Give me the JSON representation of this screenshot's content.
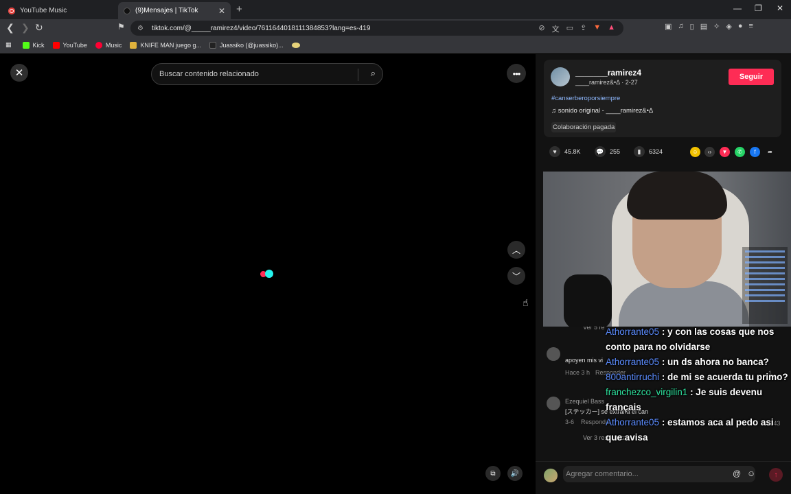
{
  "browser": {
    "tabs": [
      {
        "label": "YouTube Music",
        "icon": "youtube-music-icon",
        "active": false
      },
      {
        "label": "(9)Mensajes | TikTok",
        "icon": "tiktok-icon",
        "active": true
      }
    ],
    "address": "tiktok.com/@_____ramirez4/video/7611644018111384853?lang=es-419",
    "bookmarks": [
      {
        "label": "Kick",
        "color": "#53fc18"
      },
      {
        "label": "YouTube",
        "color": "#ff0000"
      },
      {
        "label": "Music",
        "color": "#ff0033"
      },
      {
        "label": "KNIFE MAN juego g...",
        "color": "#e0b23c"
      },
      {
        "label": "Juassiko (@juassiko)...",
        "color": "#222222"
      }
    ]
  },
  "video": {
    "search_placeholder": "Buscar contenido relacionado"
  },
  "post": {
    "username": "_______ramirez4",
    "subline": "____ramirez&•Δ · 2-27",
    "follow_label": "Seguir",
    "hashtag": "#canserberoporsiempre",
    "sound": "♫  sonido original - ____ramirez&•Δ",
    "paid_label": "Colaboración pagada",
    "likes": "45.8K",
    "comments": "255",
    "saves": "6324"
  },
  "comments": [
    {
      "name": "",
      "text": "apoyen mis vi",
      "time": "Hace 3 h",
      "reply": "Responder",
      "likes": "1"
    },
    {
      "name": "Ezequiel Bass",
      "text": "[ステッカー] se extraña el can",
      "time": "3-6",
      "reply": "Responder",
      "likes": "1143"
    }
  ],
  "see_replies_top": "Ver 5 re",
  "see_replies_bottom": "Ver 3 respuestas ⌄",
  "chat": [
    {
      "user": "Athorrante05",
      "color": "#5b8cff",
      "text": " : y con las cosas que nos conto para no olvidarse"
    },
    {
      "user": "Athorrante05",
      "color": "#5b8cff",
      "text": " : un ds ahora no banca?"
    },
    {
      "user": "800antirruchi",
      "color": "#5b8cff",
      "text": " : de mi se acuerda tu primo?"
    },
    {
      "user": "franchezco_virgilin1",
      "color": "#2ee6a0",
      "text": " : Je suis devenu français"
    },
    {
      "user": "Athorrante05",
      "color": "#5b8cff",
      "text": " : estamos aca al pedo asi que avisa"
    }
  ],
  "comment_bar": {
    "placeholder": "Agregar comentario..."
  },
  "colors": {
    "accent": "#fe2c55",
    "link": "#8fb9ff"
  }
}
